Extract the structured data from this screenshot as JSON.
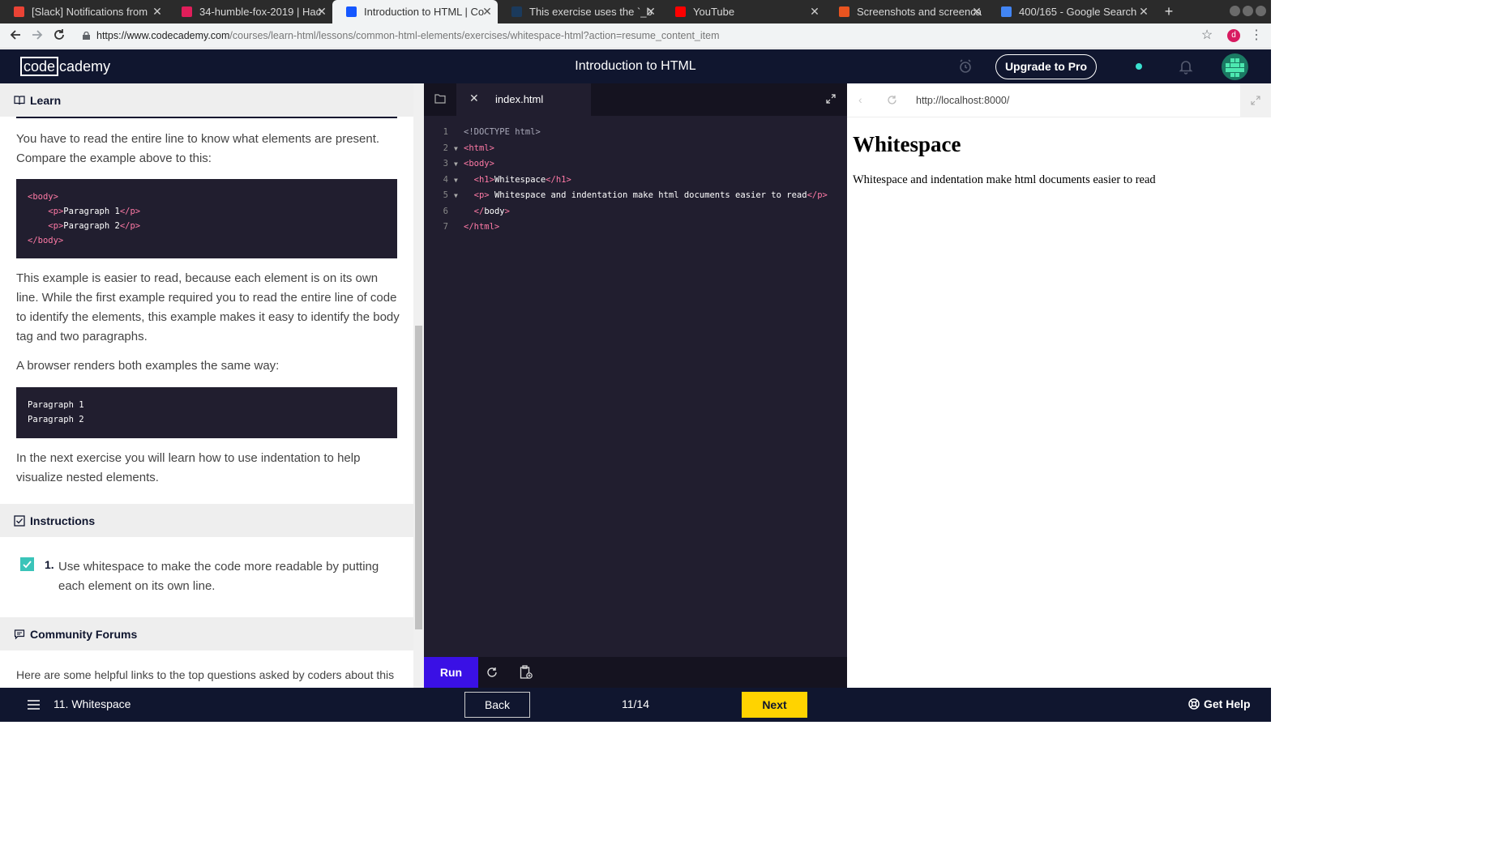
{
  "browser": {
    "tabs": [
      {
        "title": "[Slack] Notifications from",
        "icon": "gmail-icon",
        "color": "#ea4335"
      },
      {
        "title": "34-humble-fox-2019 | Hac",
        "icon": "slack-icon",
        "color": "#e01e5a"
      },
      {
        "title": "Introduction to HTML | Co",
        "icon": "codecademy-icon",
        "color": "#1557ff",
        "active": true
      },
      {
        "title": "This exercise uses the `_b",
        "icon": "codecademy-icon",
        "color": "#1b3a5c"
      },
      {
        "title": "YouTube",
        "icon": "youtube-icon",
        "color": "#ff0000"
      },
      {
        "title": "Screenshots and screenca",
        "icon": "ubuntu-icon",
        "color": "#e95420"
      },
      {
        "title": "400/165 - Google Search",
        "icon": "google-icon",
        "color": "#4285f4"
      }
    ],
    "url_host": "https://www.codecademy.com",
    "url_path": "/courses/learn-html/lessons/common-html-elements/exercises/whitespace-html?action=resume_content_item",
    "profile_initial": "d"
  },
  "header": {
    "logo_boxed": "code",
    "logo_rest": "cademy",
    "title": "Introduction to HTML",
    "upgrade_label": "Upgrade to Pro"
  },
  "learn": {
    "header": "Learn",
    "para1": "You have to read the entire line to know what elements are present. Compare the example above to this:",
    "code1": [
      {
        "open": "<body>",
        "text": "",
        "close": "",
        "indent": ""
      },
      {
        "open": "<p>",
        "text": "Paragraph 1",
        "close": "</p>",
        "indent": "    "
      },
      {
        "open": "<p>",
        "text": "Paragraph 2",
        "close": "</p>",
        "indent": "    "
      },
      {
        "open": "</body>",
        "text": "",
        "close": "",
        "indent": ""
      }
    ],
    "para2": "This example is easier to read, because each element is on its own line. While the first example required you to read the entire line of code to identify the elements, this example makes it easy to identify the body tag and two paragraphs.",
    "para3": "A browser renders both examples the same way:",
    "code2": "Paragraph 1\nParagraph 2",
    "para4": "In the next exercise you will learn how to use indentation to help visualize nested elements.",
    "instructions_header": "Instructions",
    "instruction_number": "1.",
    "instruction_text": "Use whitespace to make the code more readable by putting each element on its own line.",
    "forums_header": "Community Forums",
    "forums_text": "Here are some helpful links to the top questions asked by coders about this"
  },
  "editor": {
    "filename": "index.html",
    "run_label": "Run",
    "lines": [
      {
        "n": "1",
        "fold": "",
        "parts": [
          [
            "doctype",
            "<!DOCTYPE html>"
          ]
        ]
      },
      {
        "n": "2",
        "fold": "▼",
        "parts": [
          [
            "tag",
            "<html>"
          ]
        ]
      },
      {
        "n": "3",
        "fold": "▼",
        "parts": [
          [
            "tag",
            "<body>"
          ]
        ]
      },
      {
        "n": "4",
        "fold": "▼",
        "parts": [
          [
            "txt",
            "  "
          ],
          [
            "tag",
            "<h1>"
          ],
          [
            "txt",
            "Whitespace"
          ],
          [
            "tag",
            "</h1>"
          ]
        ]
      },
      {
        "n": "5",
        "fold": "▼",
        "parts": [
          [
            "txt",
            "  "
          ],
          [
            "tag",
            "<p>"
          ],
          [
            "txt",
            " Whitespace and indentation make html documents easier to read"
          ],
          [
            "tag",
            "</p>"
          ]
        ]
      },
      {
        "n": "6",
        "fold": "",
        "parts": [
          [
            "txt",
            "  "
          ],
          [
            "tag",
            "</"
          ],
          [
            "txt",
            "body"
          ],
          [
            "tag",
            ">"
          ]
        ]
      },
      {
        "n": "7",
        "fold": "",
        "parts": [
          [
            "tag",
            "</html>"
          ]
        ]
      }
    ]
  },
  "preview": {
    "url": "http://localhost:8000/",
    "h1": "Whitespace",
    "p": "Whitespace and indentation make html documents easier to read"
  },
  "footer": {
    "lesson_title": "11. Whitespace",
    "back_label": "Back",
    "progress": "11/14",
    "next_label": "Next",
    "help_label": "Get Help"
  },
  "colors": {
    "brand_navy": "#10162f",
    "run_purple": "#3a10e5",
    "next_yellow": "#ffd300",
    "check_teal": "#3ac4b9",
    "code_bg": "#211e2f",
    "tag_pink": "#ff7aa6"
  }
}
